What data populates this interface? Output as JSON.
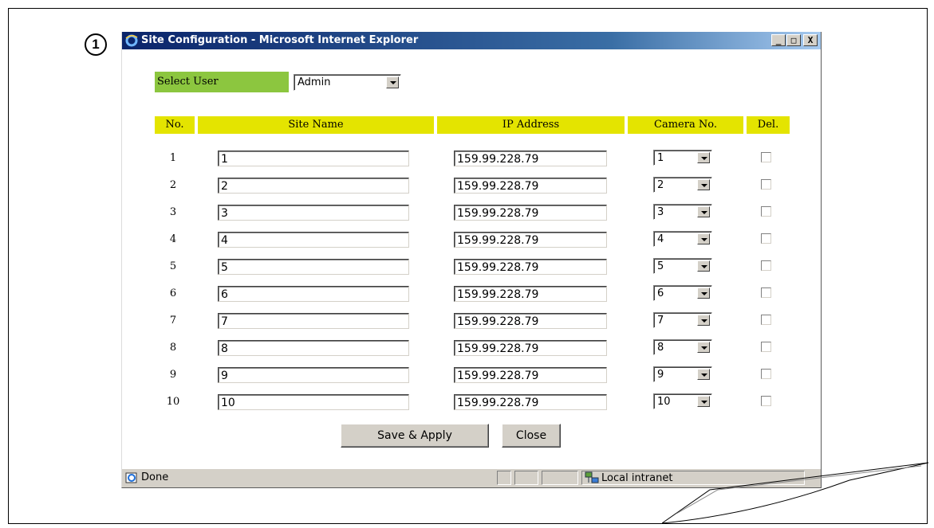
{
  "badge": "1",
  "window": {
    "title": "Site Configuration - Microsoft Internet Explorer",
    "buttons": {
      "minimize": "_",
      "maximize": "□",
      "close": "X"
    }
  },
  "select_user": {
    "label": "Select User",
    "value": "Admin"
  },
  "table": {
    "headers": {
      "no": "No.",
      "site_name": "Site Name",
      "ip": "IP Address",
      "camera": "Camera No.",
      "del": "Del."
    },
    "rows": [
      {
        "no": "1",
        "site_name": "1",
        "ip": "159.99.228.79",
        "camera": "1"
      },
      {
        "no": "2",
        "site_name": "2",
        "ip": "159.99.228.79",
        "camera": "2"
      },
      {
        "no": "3",
        "site_name": "3",
        "ip": "159.99.228.79",
        "camera": "3"
      },
      {
        "no": "4",
        "site_name": "4",
        "ip": "159.99.228.79",
        "camera": "4"
      },
      {
        "no": "5",
        "site_name": "5",
        "ip": "159.99.228.79",
        "camera": "5"
      },
      {
        "no": "6",
        "site_name": "6",
        "ip": "159.99.228.79",
        "camera": "6"
      },
      {
        "no": "7",
        "site_name": "7",
        "ip": "159.99.228.79",
        "camera": "7"
      },
      {
        "no": "8",
        "site_name": "8",
        "ip": "159.99.228.79",
        "camera": "8"
      },
      {
        "no": "9",
        "site_name": "9",
        "ip": "159.99.228.79",
        "camera": "9"
      },
      {
        "no": "10",
        "site_name": "10",
        "ip": "159.99.228.79",
        "camera": "10"
      }
    ]
  },
  "actions": {
    "save": "Save & Apply",
    "close": "Close"
  },
  "status": {
    "left": "Done",
    "zone": "Local intranet"
  },
  "colors": {
    "header": "#e4e400",
    "select_user": "#8cc63f",
    "titlebar": "#0a246a"
  }
}
